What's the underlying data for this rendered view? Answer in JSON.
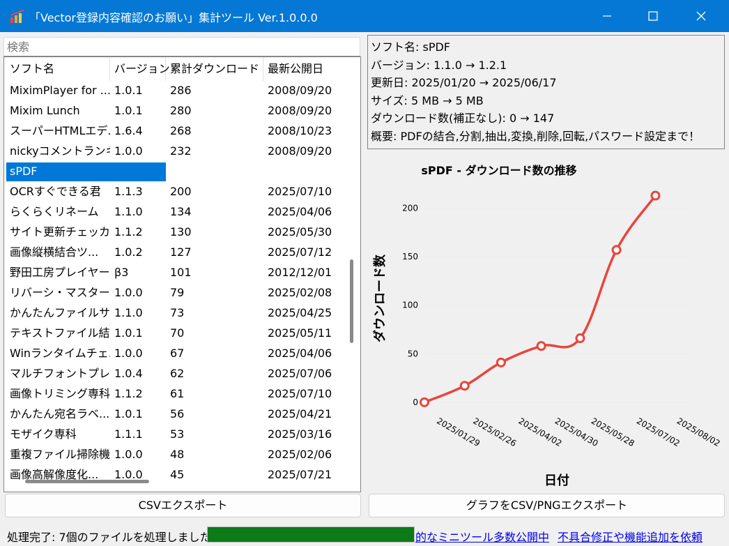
{
  "window": {
    "title": "「Vector登録内容確認のお願い」集計ツール Ver.1.0.0.0"
  },
  "search": {
    "placeholder": "検索"
  },
  "table": {
    "columns": [
      "ソフト名",
      "バージョン",
      "累計ダウンロード",
      "最新公開日"
    ],
    "rows": [
      [
        "MiximPlayer for ...",
        "1.0.1",
        "286",
        "2008/09/20"
      ],
      [
        "Mixim Lunch",
        "1.0.1",
        "280",
        "2008/09/20"
      ],
      [
        "スーパーHTMLエデ...",
        "1.6.4",
        "268",
        "2008/10/23"
      ],
      [
        "nickyコメントランキ...",
        "1.0.0",
        "232",
        "2008/09/20"
      ],
      [
        "sPDF",
        "",
        "",
        ""
      ],
      [
        "OCRすぐできる君",
        "1.1.3",
        "200",
        "2025/07/10"
      ],
      [
        "らくらくリネーム",
        "1.1.0",
        "134",
        "2025/04/06"
      ],
      [
        "サイト更新チェッカー",
        "1.1.2",
        "130",
        "2025/05/30"
      ],
      [
        "画像縦横結合ツ...",
        "1.0.2",
        "127",
        "2025/07/12"
      ],
      [
        "野田工房プレイヤー",
        "β3",
        "101",
        "2012/12/01"
      ],
      [
        "リバーシ・マスター",
        "1.0.0",
        "79",
        "2025/02/08"
      ],
      [
        "かんたんファイルサ...",
        "1.1.0",
        "73",
        "2025/04/25"
      ],
      [
        "テキストファイル結...",
        "1.0.1",
        "70",
        "2025/05/11"
      ],
      [
        "Winランタイムチェ...",
        "1.0.0",
        "67",
        "2025/04/06"
      ],
      [
        "マルチフォントプレ...",
        "1.0.4",
        "62",
        "2025/07/06"
      ],
      [
        "画像トリミング専科",
        "1.1.2",
        "61",
        "2025/07/10"
      ],
      [
        "かんたん宛名ラベ...",
        "1.0.1",
        "56",
        "2025/04/21"
      ],
      [
        "モザイク専科",
        "1.1.1",
        "53",
        "2025/03/16"
      ],
      [
        "重複ファイル掃除機",
        "1.0.0",
        "48",
        "2025/02/06"
      ],
      [
        "画像高解像度化...",
        "1.0.0",
        "45",
        "2025/07/21"
      ]
    ],
    "selected_index": 4
  },
  "info": {
    "lines": [
      "ソフト名: sPDF",
      "バージョン: 1.1.0 → 1.2.1",
      "更新日: 2025/01/20 → 2025/06/17",
      "サイズ: 5 MB → 5 MB",
      "ダウンロード数(補正なし): 0 → 147",
      "概要: PDFの結合,分割,抽出,変換,削除,回転,パスワード設定まで！"
    ]
  },
  "buttons": {
    "csv_export": "CSVエクスポート",
    "graph_export": "グラフをCSV/PNGエクスポート"
  },
  "status": {
    "text": "処理完了: 7個のファイルを処理しました",
    "progress": 1.0,
    "link1": "的なミニツール多数公開中",
    "link2": "不具合修正や機能追加を依頼"
  },
  "colors": {
    "titlebar": "#0478d4",
    "selection": "#0078d7",
    "line": "#e8453c",
    "progress": "#0d7a18"
  },
  "chart_data": {
    "type": "line",
    "title": "sPDF - ダウンロード数の推移",
    "xlabel": "日付",
    "ylabel": "ダウンロード数",
    "x_ticks": [
      "2025/01/29",
      "2025/02/26",
      "2025/04/02",
      "2025/04/30",
      "2025/05/28",
      "2025/07/02",
      "2025/08/02"
    ],
    "y_ticks": [
      0,
      50,
      100,
      150,
      200
    ],
    "xlim": [
      "2025/01/20",
      "2025/08/11"
    ],
    "ylim": [
      -8,
      222
    ],
    "series": [
      {
        "x": [
          "2025/01/20",
          "2025/02/20",
          "2025/03/20",
          "2025/04/20",
          "2025/05/20",
          "2025/06/17",
          "2025/07/17"
        ],
        "y": [
          0,
          17,
          41,
          58,
          66,
          157,
          213
        ]
      }
    ],
    "grid": true,
    "legend": "none"
  }
}
